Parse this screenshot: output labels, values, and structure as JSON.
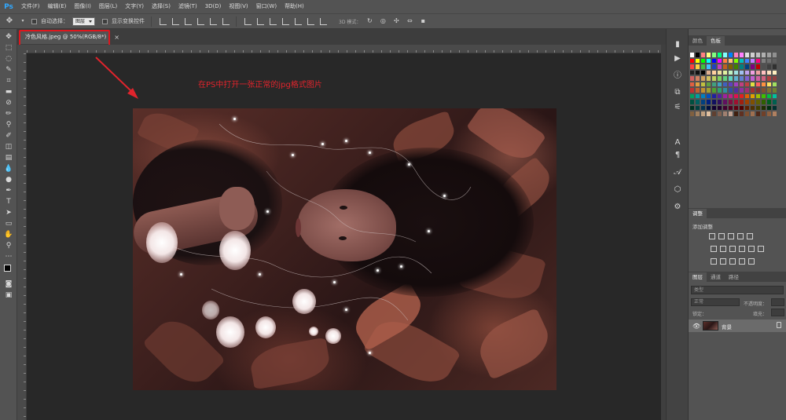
{
  "app": {
    "logo": "Ps"
  },
  "menu": [
    "文件(F)",
    "编辑(E)",
    "图像(I)",
    "图层(L)",
    "文字(Y)",
    "选择(S)",
    "滤镜(T)",
    "3D(D)",
    "视图(V)",
    "窗口(W)",
    "帮助(H)"
  ],
  "options": {
    "auto_select_label": "自动选择：",
    "auto_select_value": "图层",
    "show_transform_label": "显示变换控件",
    "mode_3d_label": "3D 模式："
  },
  "document": {
    "tab_title": "冷色风格.jpeg @ 50%(RGB/8*)",
    "tab_close": "×"
  },
  "annotation": {
    "text": "在PS中打开一张正常的jpg格式图片",
    "color": "#e0242c"
  },
  "panels": {
    "color_tabs": [
      "颜色",
      "色板"
    ],
    "adjustments_tab": "调整",
    "adjustments_label": "添加调整",
    "layers_tabs": [
      "图层",
      "通道",
      "路径"
    ],
    "layers_search_placeholder": "类型",
    "blend_mode": "正常",
    "opacity_label": "不透明度：",
    "lock_label": "锁定：",
    "fill_label": "填充：",
    "layer_name": "背景"
  },
  "swatch_colors": [
    "#ffffff",
    "#000000",
    "#ff8080",
    "#ffff80",
    "#80ff80",
    "#00ff80",
    "#80ffff",
    "#0080ff",
    "#ff80c0",
    "#ff80ff",
    "#e0e0e0",
    "#d0d0d0",
    "#c0c0c0",
    "#b0b0b0",
    "#a0a0a0",
    "#909090",
    "#ff0000",
    "#ffff00",
    "#00ff00",
    "#00ffff",
    "#0000ff",
    "#ff00ff",
    "#ff8040",
    "#ffc080",
    "#80ff00",
    "#00c0c0",
    "#4080ff",
    "#c080ff",
    "#ff0080",
    "#808080",
    "#707070",
    "#606060",
    "#ff4040",
    "#ffd040",
    "#40c040",
    "#40c0ff",
    "#2040c0",
    "#c040c0",
    "#c06020",
    "#806000",
    "#408000",
    "#008080",
    "#004080",
    "#800080",
    "#c00000",
    "#505050",
    "#404040",
    "#303030",
    "#202020",
    "#101010",
    "#000000",
    "#e0b090",
    "#ffd0a0",
    "#f0e0a0",
    "#e0f0a0",
    "#c0f0c0",
    "#a0e0e0",
    "#a0c0f0",
    "#c0a0f0",
    "#f0a0e0",
    "#f0a0a0",
    "#ffc0c0",
    "#ffe0c0",
    "#fff0c0",
    "#d06060",
    "#d08060",
    "#d0a060",
    "#d0c060",
    "#c0d060",
    "#80d060",
    "#60d080",
    "#60d0c0",
    "#60b0d0",
    "#6080d0",
    "#8060d0",
    "#c060d0",
    "#d060a0",
    "#d06080",
    "#b04040",
    "#904040",
    "#e06040",
    "#e0a040",
    "#c0c040",
    "#60a040",
    "#40a080",
    "#40a0c0",
    "#4060c0",
    "#6040c0",
    "#a040c0",
    "#c04080",
    "#c04040",
    "#e0e040",
    "#ff6060",
    "#ff9040",
    "#ffe060",
    "#a0e060",
    "#c03030",
    "#c06030",
    "#c09030",
    "#a0a030",
    "#50a030",
    "#30a070",
    "#3090a0",
    "#3050a0",
    "#5030a0",
    "#9030a0",
    "#a03070",
    "#a03030",
    "#803030",
    "#805030",
    "#807030",
    "#708030",
    "#00a060",
    "#00a0a0",
    "#0080c0",
    "#0050c0",
    "#2020a0",
    "#5020a0",
    "#a020a0",
    "#c02080",
    "#e01050",
    "#e02020",
    "#e06000",
    "#e0a000",
    "#a0c000",
    "#40c000",
    "#00c040",
    "#00c0a0",
    "#005040",
    "#006060",
    "#004080",
    "#002080",
    "#101060",
    "#301060",
    "#601060",
    "#801040",
    "#a01030",
    "#a02010",
    "#a04000",
    "#805000",
    "#606000",
    "#306000",
    "#006020",
    "#006050",
    "#003020",
    "#004040",
    "#003050",
    "#001040",
    "#100030",
    "#200030",
    "#400030",
    "#500020",
    "#600010",
    "#500000",
    "#602000",
    "#503000",
    "#404000",
    "#203000",
    "#003010",
    "#003030",
    "#806040",
    "#a08060",
    "#c0a080",
    "#e0c0a0",
    "#604030",
    "#806050",
    "#a08070",
    "#c0a090",
    "#402010",
    "#603020",
    "#805030",
    "#a07050",
    "#502818",
    "#704028",
    "#906040",
    "#b08060"
  ]
}
